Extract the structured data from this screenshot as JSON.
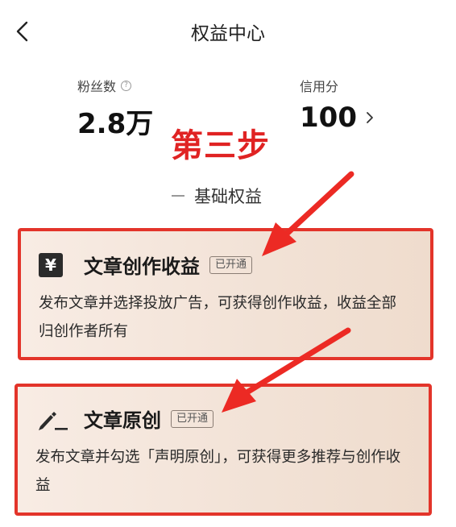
{
  "header": {
    "title": "权益中心"
  },
  "stats": {
    "fans": {
      "label": "粉丝数",
      "value": "2.8万"
    },
    "credit": {
      "label": "信用分",
      "value": "100"
    }
  },
  "annotation": {
    "step_label": "第三步",
    "color": "#e02323"
  },
  "section": {
    "title": "基础权益"
  },
  "benefits": [
    {
      "icon_text": "¥",
      "title": "文章创作收益",
      "badge": "已开通",
      "description": "发布文章并选择投放广告，可获得创作收益，收益全部归创作者所有"
    },
    {
      "icon": "pen-icon",
      "title": "文章原创",
      "badge": "已开通",
      "description": "发布文章并勾选「声明原创」，可获得更多推荐与创作收益"
    }
  ],
  "colors": {
    "highlight_border": "#e3342a",
    "card_bg": "#f5e6dc"
  }
}
